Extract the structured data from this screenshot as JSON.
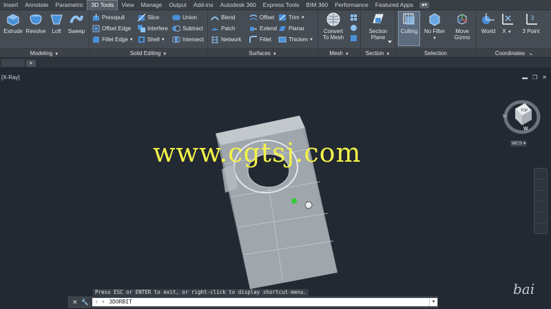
{
  "menu_tabs": [
    "Insert",
    "Annotate",
    "Parametric",
    "3D Tools",
    "View",
    "Manage",
    "Output",
    "Add-ins",
    "Autodesk 360",
    "Express Tools",
    "BIM 360",
    "Performance",
    "Featured Apps"
  ],
  "active_tab": "3D Tools",
  "ribbon": {
    "modeling": {
      "title": "Modeling",
      "buttons": [
        "Extrude",
        "Revolve",
        "Loft",
        "Sweep"
      ]
    },
    "solid_editing": {
      "title": "Solid Editing",
      "buttons": [
        "Presspull",
        "Offset Edge",
        "Fillet Edge",
        "Slice",
        "Interfere",
        "Shell",
        "Union",
        "Subtract",
        "Intersect"
      ]
    },
    "surfaces": {
      "title": "Surfaces",
      "buttons": [
        "Blend",
        "Patch",
        "Network",
        "Offset",
        "Extend",
        "Fillet",
        "Trim",
        "Planar",
        "Thicken"
      ]
    },
    "mesh": {
      "title": "Mesh",
      "convert_label_1": "Convert",
      "convert_label_2": "To Mesh"
    },
    "section": {
      "title": "Section",
      "label_1": "Section",
      "label_2": "Plane"
    },
    "selection": {
      "title": "Selection",
      "culling": "Culling",
      "no_filter": "No Filter",
      "move_1": "Move",
      "move_2": "Gizmo"
    },
    "coordinates": {
      "title": "Coordinates",
      "world": "World",
      "x": "X",
      "three_point": "3 Point"
    }
  },
  "viewport": {
    "view_label": "[X-Ray]",
    "wcs_label": "WCS",
    "compass": {
      "n": "N",
      "w": "W"
    },
    "watermark": "www.cgtsj.com",
    "corner_mark": "bai"
  },
  "command": {
    "message": "Press ESC or ENTER to exit, or right-click to display shortcut-menu.",
    "current": "3DORBIT"
  },
  "colors": {
    "background": "#222932",
    "ribbon": "#464c54",
    "watermark": "#f2f24a",
    "accent": "#5c6b7d"
  }
}
